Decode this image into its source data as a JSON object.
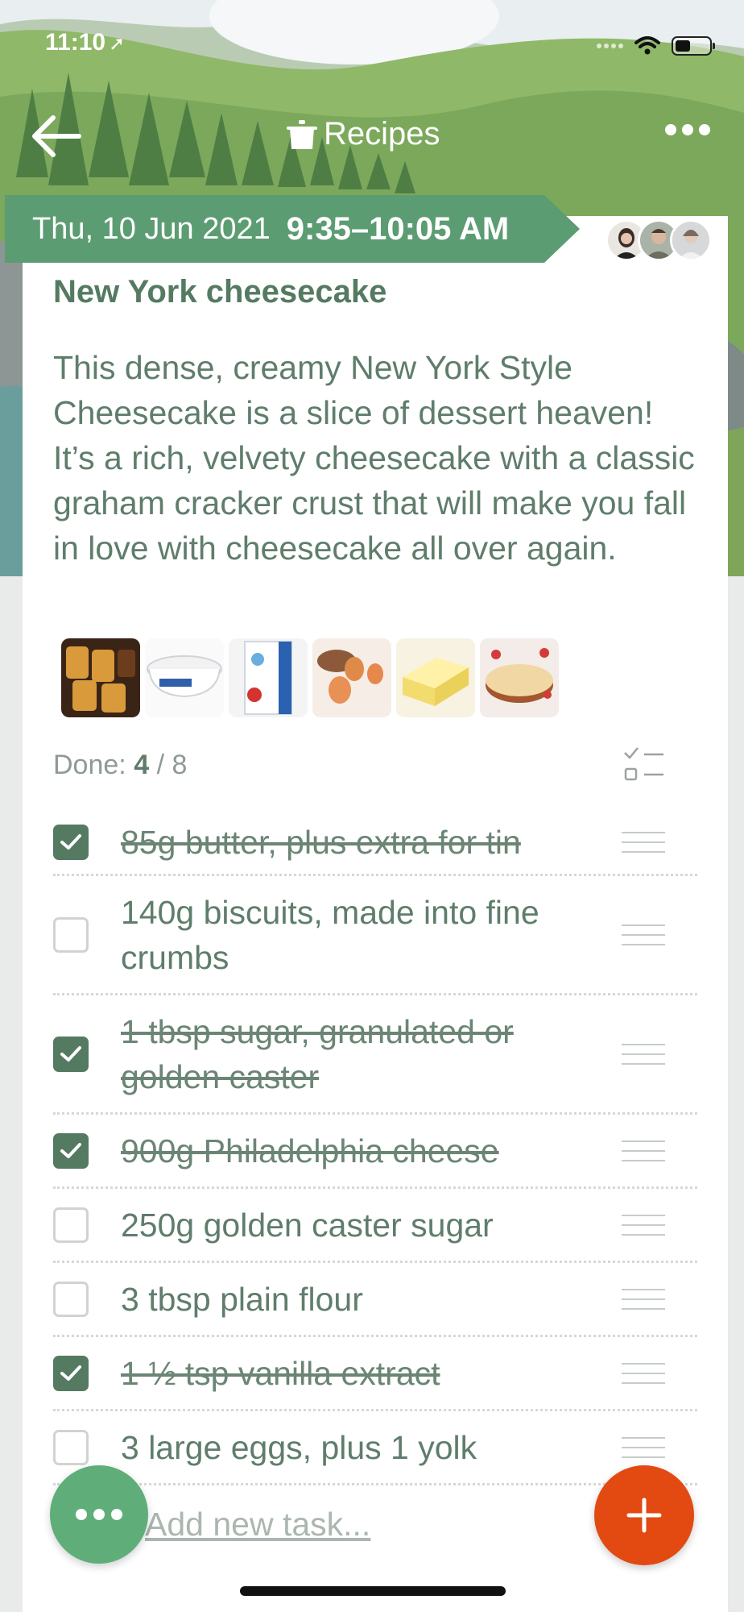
{
  "status": {
    "time": "11:10"
  },
  "nav": {
    "title": "Recipes"
  },
  "event": {
    "date": "Thu, 10 Jun 2021",
    "time": "9:35–10:05 AM"
  },
  "recipe": {
    "title": "New York cheesecake",
    "description": "This dense, creamy New York Style Cheesecake is a slice of dessert heaven! It’s a rich, velvety cheesecake with a classic graham cracker crust that will make you fall in love with cheesecake all over again."
  },
  "progress": {
    "label": "Done:",
    "done": "4",
    "sep": "/",
    "total": "8"
  },
  "tasks": [
    {
      "text": "85g butter, plus extra for tin",
      "checked": true
    },
    {
      "text": "140g biscuits, made into fine crumbs",
      "checked": false
    },
    {
      "text": "1 tbsp sugar, granulated or golden caster",
      "checked": true
    },
    {
      "text": "900g Philadelphia cheese",
      "checked": true
    },
    {
      "text": "250g golden caster sugar",
      "checked": false
    },
    {
      "text": "3 tbsp plain flour",
      "checked": false
    },
    {
      "text": "1 ½ tsp vanilla extract",
      "checked": true
    },
    {
      "text": "3 large eggs,  plus 1 yolk",
      "checked": false
    }
  ],
  "add_task": {
    "placeholder": "Add new task..."
  },
  "colors": {
    "accent": "#557a62",
    "banner": "#5c9c72",
    "fab_add": "#e24a12",
    "fab_more": "#5fae79"
  }
}
